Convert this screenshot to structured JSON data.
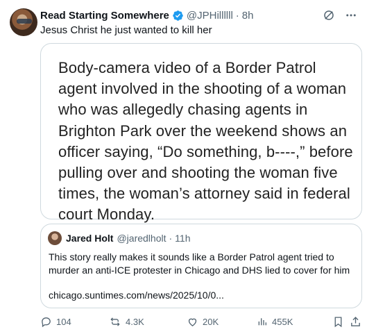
{
  "tweet": {
    "author_name": "Read Starting Somewhere",
    "handle": "@JPHillllll",
    "separator": "·",
    "time": "8h",
    "text": "Jesus Christ he just wanted to kill her"
  },
  "image_card": {
    "text": "Body-camera video of a Border Patrol agent involved in the shooting of a woman who was allegedly chasing agents in Brighton Park over the weekend shows an officer saying, “Do something, b----,” before pulling over and shooting the woman five times, the woman’s attorney said in federal court Monday."
  },
  "quote": {
    "author_name": "Jared Holt",
    "handle": "@jaredlholt",
    "separator": "·",
    "time": "11h",
    "text": "This story really makes it sounds like a Border Patrol agent tried to murder an anti-ICE protester in Chicago and DHS lied to cover for him",
    "link": "chicago.suntimes.com/news/2025/10/0..."
  },
  "actions": {
    "replies": "104",
    "reposts": "4.3K",
    "likes": "20K",
    "views": "455K"
  },
  "colors": {
    "verified": "#1d9bf0",
    "secondary_text": "#536471",
    "border": "#cfd9de"
  },
  "icons": [
    "verified-badge-icon",
    "grok-icon",
    "more-icon",
    "reply-icon",
    "repost-icon",
    "like-icon",
    "views-icon",
    "bookmark-icon",
    "share-icon"
  ]
}
